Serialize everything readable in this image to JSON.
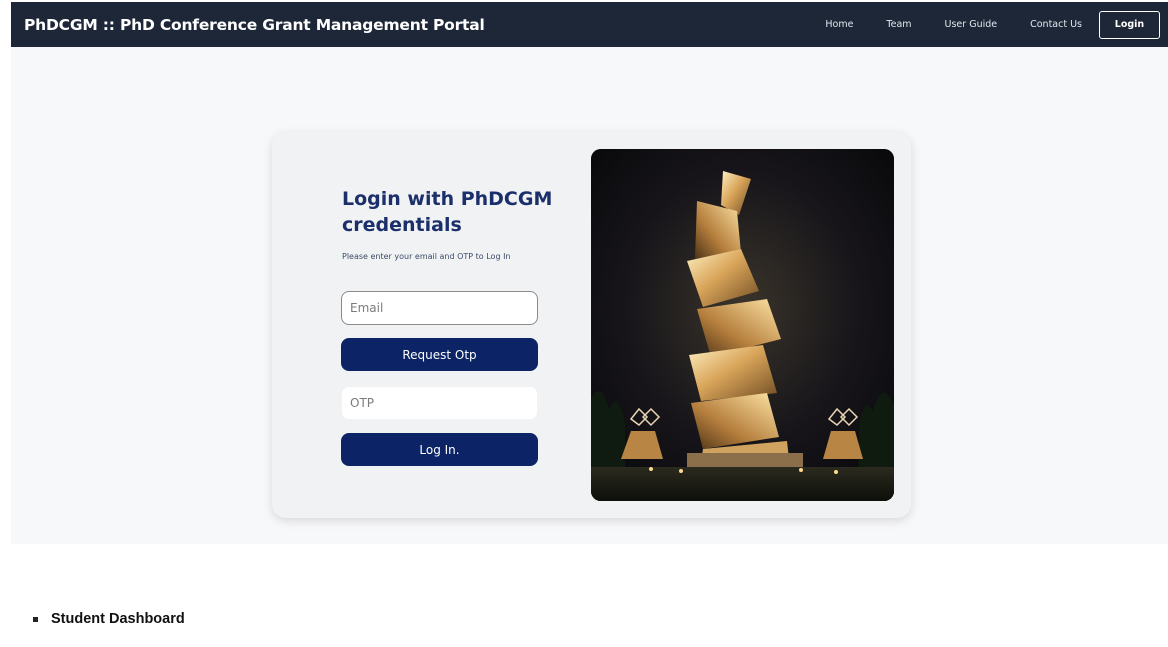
{
  "navbar": {
    "brand": "PhDCGM :: PhD Conference Grant Management Portal",
    "links": [
      "Home",
      "Team",
      "User Guide",
      "Contact Us"
    ],
    "login_button": "Login"
  },
  "login": {
    "title": "Login with PhDCGM credentials",
    "subtitle": "Please enter your email and OTP to Log In",
    "email": {
      "placeholder": "Email",
      "value": ""
    },
    "request_otp_button": "Request Otp",
    "otp": {
      "placeholder": "OTP",
      "value": ""
    },
    "login_button": "Log In."
  },
  "image": {
    "subject": "illuminated sculpture monument at night"
  },
  "bottom_list": {
    "items": [
      "Student Dashboard"
    ]
  },
  "colors": {
    "navbar_bg": "#1e2738",
    "primary_button": "#0c2466",
    "title": "#1b2f6b",
    "hero_bg": "#f7f8fa"
  }
}
